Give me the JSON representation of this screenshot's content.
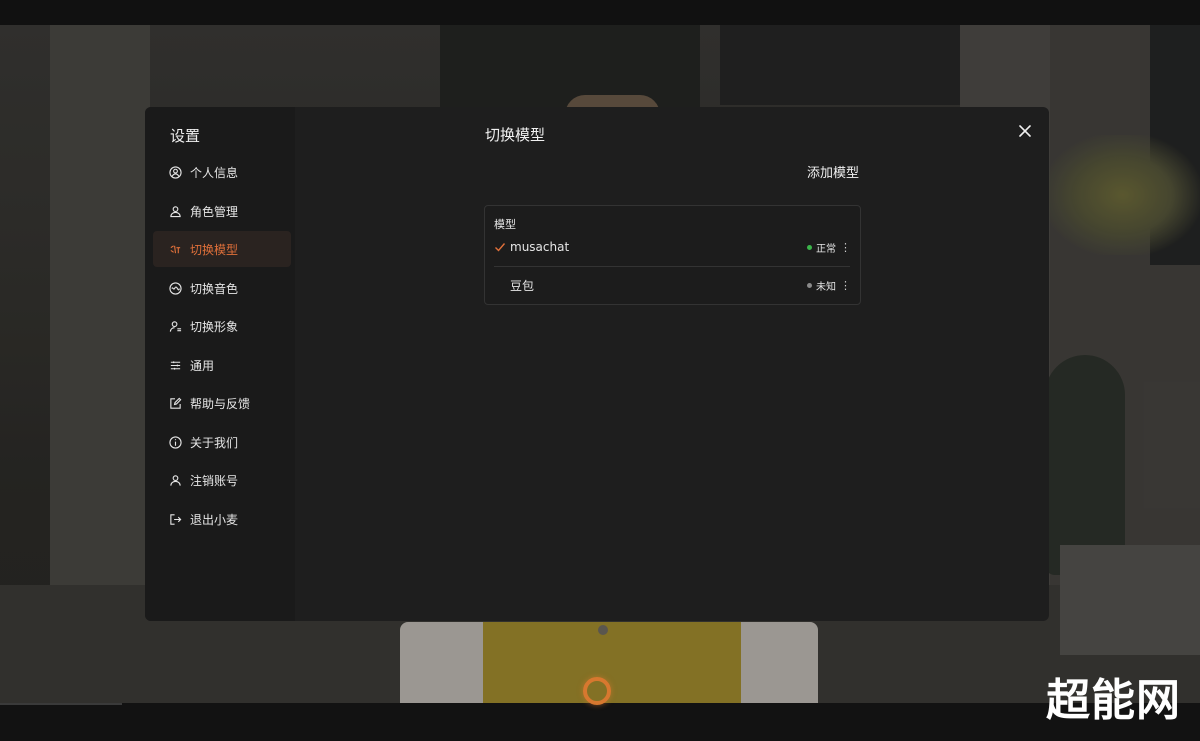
{
  "settings": {
    "title": "设置",
    "nav": [
      {
        "label": "个人信息",
        "icon": "user-circle-icon",
        "active": false
      },
      {
        "label": "角色管理",
        "icon": "user-icon",
        "active": false
      },
      {
        "label": "切换模型",
        "icon": "model-switch-icon",
        "active": true
      },
      {
        "label": "切换音色",
        "icon": "voice-switch-icon",
        "active": false
      },
      {
        "label": "切换形象",
        "icon": "avatar-switch-icon",
        "active": false
      },
      {
        "label": "通用",
        "icon": "sliders-icon",
        "active": false
      },
      {
        "label": "帮助与反馈",
        "icon": "edit-icon",
        "active": false
      },
      {
        "label": "关于我们",
        "icon": "info-icon",
        "active": false
      },
      {
        "label": "注销账号",
        "icon": "user-delete-icon",
        "active": false
      },
      {
        "label": "退出小麦",
        "icon": "logout-icon",
        "active": false
      }
    ]
  },
  "main": {
    "title": "切换模型",
    "add_model_label": "添加模型",
    "card_label": "模型",
    "models": [
      {
        "name": "musachat",
        "selected": true,
        "status": "正常",
        "status_color": "#3bb54a",
        "more": "⋮"
      },
      {
        "name": "豆包",
        "selected": false,
        "status": "未知",
        "status_color": "#8a8a8a",
        "more": "⋮"
      }
    ]
  },
  "watermark": "超能网",
  "colors": {
    "accent": "#e0703a",
    "modal_bg": "#1e1e1e",
    "sidebar_bg": "#1a1a1a",
    "mic_ring": "#d7782f"
  }
}
